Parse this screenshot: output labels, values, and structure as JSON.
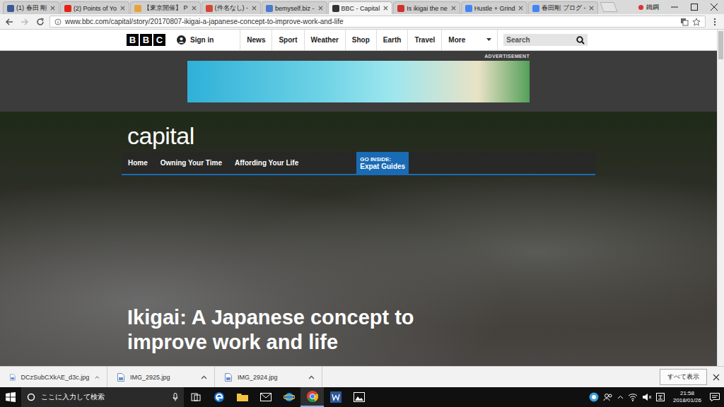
{
  "browser": {
    "tabs": [
      {
        "label": "(1) 春田 剛",
        "selected": false,
        "color": "#3b5998"
      },
      {
        "label": "(2) Points of Yo",
        "selected": false,
        "color": "#e62117"
      },
      {
        "label": "【東京開催】 P",
        "selected": false,
        "color": "#e8a23a"
      },
      {
        "label": "(件名なし) -",
        "selected": false,
        "color": "#d44638"
      },
      {
        "label": "bemyself.biz -",
        "selected": false,
        "color": "#4a7bd0"
      },
      {
        "label": "BBC - Capital",
        "selected": true,
        "color": "#333333"
      },
      {
        "label": "Is ikigai the ne",
        "selected": false,
        "color": "#d0312d"
      },
      {
        "label": "Hustle + Grind",
        "selected": false,
        "color": "#4285f4"
      },
      {
        "label": "春田剛 ブログ -",
        "selected": false,
        "color": "#4285f4"
      }
    ],
    "profile": "鐵鋼"
  },
  "address_bar": {
    "url": "www.bbc.com/capital/story/20170807-ikigai-a-japanese-concept-to-improve-work-and-life"
  },
  "site_nav": {
    "logo": [
      "B",
      "B",
      "C"
    ],
    "sign_in": "Sign in",
    "items": [
      "News",
      "Sport",
      "Weather",
      "Shop",
      "Earth",
      "Travel"
    ],
    "more": "More",
    "search_placeholder": "Search"
  },
  "advertisement": {
    "label": "ADVERTISEMENT"
  },
  "capital": {
    "logo": "capital",
    "nav": [
      "Home",
      "Owning Your Time",
      "Affording Your Life"
    ],
    "go_inside": {
      "label": "GO INSIDE:",
      "link": "Expat Guides"
    },
    "headline": "Ikigai: A Japanese concept to improve work and life"
  },
  "downloads": {
    "items": [
      "DCzSubCXkAE_d3c.jpg",
      "IMG_2925.jpg",
      "IMG_2924.jpg"
    ],
    "show_all": "すべて表示"
  },
  "taskbar": {
    "search_placeholder": "ここに入力して検索",
    "time": "21:58",
    "date": "2018/01/26"
  }
}
